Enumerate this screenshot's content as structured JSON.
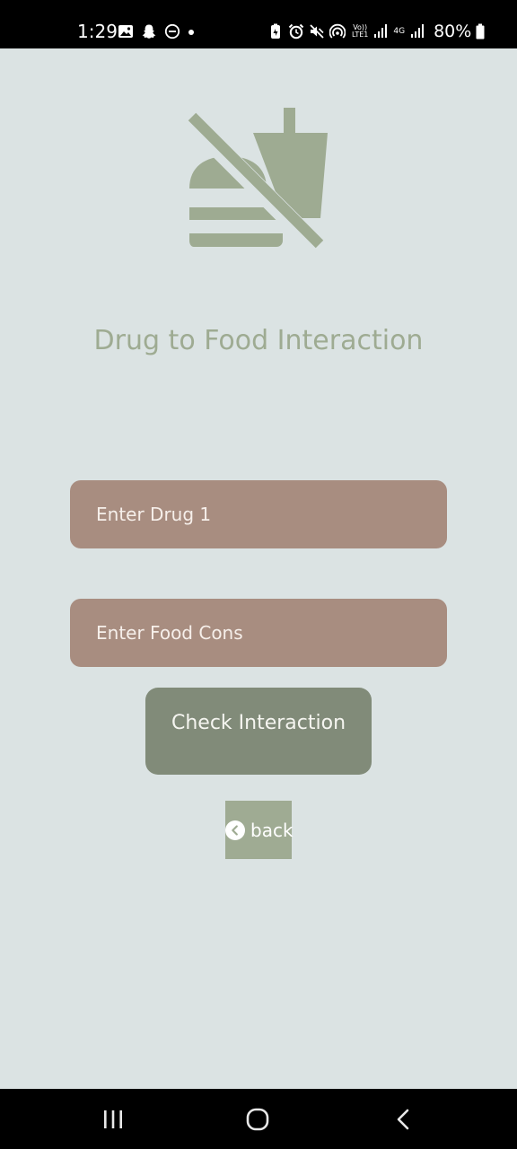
{
  "status_bar": {
    "time": "1:29",
    "battery": "80%",
    "network_top": "Vo))",
    "network_bottom": "LTE1",
    "network_4g": "4G",
    "left_icons": [
      "gallery-icon",
      "snapchat-icon",
      "do-not-disturb-icon",
      "dot-icon"
    ],
    "right_icons": [
      "battery-saver-icon",
      "alarm-icon",
      "mute-icon",
      "hotspot-icon",
      "signal-icon",
      "signal-icon",
      "battery-icon"
    ]
  },
  "header": {
    "icon": "no-food-icon",
    "title": "Drug to Food Interaction"
  },
  "form": {
    "drug_placeholder": "Enter Drug 1",
    "food_placeholder": "Enter Food Cons",
    "check_label": "Check Interaction",
    "back_label": "back"
  },
  "nav_bar": {
    "icons": [
      "recents-icon",
      "home-icon",
      "back-icon"
    ]
  },
  "colors": {
    "background": "#dbe3e3",
    "accent": "#9eab92",
    "input_bg": "#a88d80",
    "button_bg": "#818b79"
  }
}
